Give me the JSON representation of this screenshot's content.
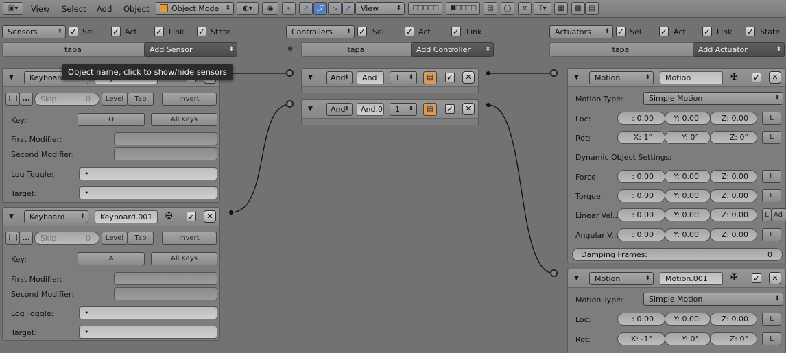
{
  "header": {
    "menus": [
      "View",
      "Select",
      "Add",
      "Object"
    ],
    "mode": "Object Mode",
    "transform_orientation": "View"
  },
  "sensors": {
    "title": "Sensors",
    "toggles": [
      "Sel",
      "Act",
      "Link",
      "State"
    ],
    "object_name": "tapa",
    "add_label": "Add Sensor",
    "tooltip": "Object name, click to show/hide sensors",
    "items": [
      {
        "type": "Keyboard",
        "name": "Keyboard",
        "skip_label": "Skip:",
        "skip_value": "0",
        "level": "Level",
        "tap": "Tap",
        "invert": "Invert",
        "key_label": "Key:",
        "key": "Q",
        "all_keys": "All Keys",
        "first_modifier": "First Modifier:",
        "second_modifier": "Second Modifier:",
        "log_toggle": "Log Toggle:",
        "target": "Target:"
      },
      {
        "type": "Keyboard",
        "name": "Keyboard.001",
        "skip_label": "Skip:",
        "skip_value": "0",
        "level": "Level",
        "tap": "Tap",
        "invert": "Invert",
        "key_label": "Key:",
        "key": "A",
        "all_keys": "All Keys",
        "first_modifier": "First Modifier:",
        "second_modifier": "Second Modifier:",
        "log_toggle": "Log Toggle:",
        "target": "Target:"
      }
    ]
  },
  "controllers": {
    "title": "Controllers",
    "toggles": [
      "Sel",
      "Act",
      "Link"
    ],
    "object_name": "tapa",
    "add_label": "Add Controller",
    "items": [
      {
        "type": "And",
        "name": "And",
        "state": "1"
      },
      {
        "type": "And",
        "name": "And.0",
        "state": "1"
      }
    ]
  },
  "actuators": {
    "title": "Actuators",
    "toggles": [
      "Sel",
      "Act",
      "Link",
      "State"
    ],
    "object_name": "tapa",
    "add_label": "Add Actuator",
    "items": [
      {
        "type": "Motion",
        "name": "Motion",
        "motion_type_label": "Motion Type:",
        "motion_type": "Simple Motion",
        "loc_label": "Loc:",
        "loc": [
          ":  0.00",
          "Y: 0.00",
          "Z: 0.00"
        ],
        "rot_label": "Rot:",
        "rot": [
          "X:   1°",
          "Y:    0°",
          "Z:    0°"
        ],
        "dynamic_label": "Dynamic Object Settings:",
        "force_label": "Force:",
        "force": [
          ":  0.00",
          "Y: 0.00",
          "Z: 0.00"
        ],
        "torque_label": "Torque:",
        "torque": [
          ":  0.00",
          "Y: 0.00",
          "Z: 0.00"
        ],
        "linvel_label": "Linear Vel...",
        "linvel": [
          ":  0.00",
          "Y: 0.00",
          "Z: 0.00"
        ],
        "angvel_label": "Angular V...",
        "angvel": [
          ":  0.00",
          "Y: 0.00",
          "Z: 0.00"
        ],
        "damping_label": "Damping Frames:",
        "damping_value": "0",
        "local": "L",
        "add": "Ad"
      },
      {
        "type": "Motion",
        "name": "Motion.001",
        "motion_type_label": "Motion Type:",
        "motion_type": "Simple Motion",
        "loc_label": "Loc:",
        "loc": [
          ":  0.00",
          "Y: 0.00",
          "Z: 0.00"
        ],
        "rot_label": "Rot:",
        "rot": [
          "X:  -1°",
          "Y:    0°",
          "Z:    0°"
        ],
        "local": "L"
      }
    ]
  }
}
